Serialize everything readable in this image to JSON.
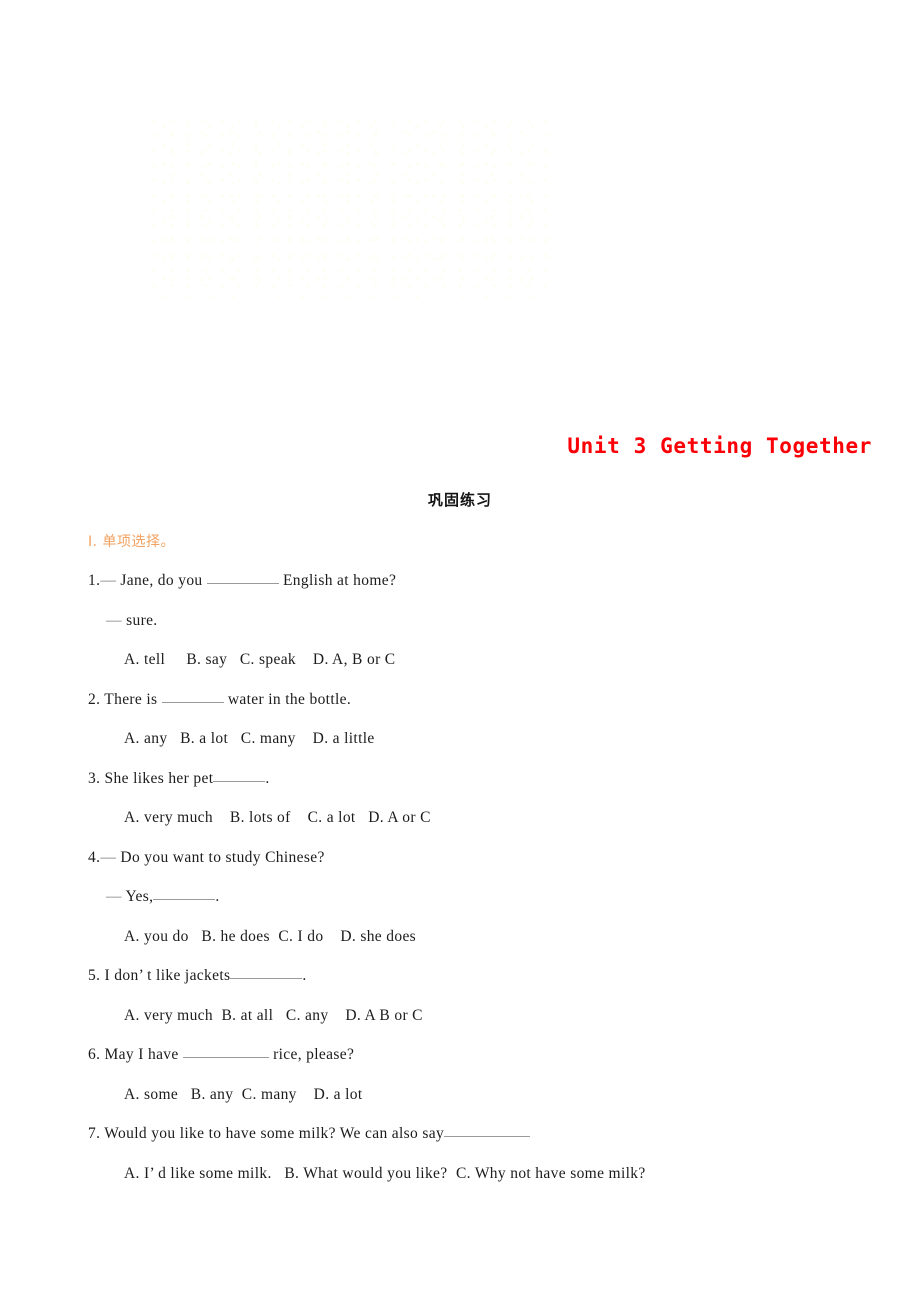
{
  "document": {
    "title": "Unit 3 Getting Together",
    "subtitle": "巩固练习",
    "title_color": "#fb0007",
    "heading_color": "#f2a261",
    "body_color": "#1c1c1c"
  },
  "watermark": {
    "present": true,
    "color": "#fffde0"
  },
  "section": {
    "label": "Ⅰ. 单项选择。"
  },
  "questions": [
    {
      "number": "1.",
      "dash": "—",
      "stem_before": " Jane, do you ",
      "blank": "blank",
      "stem_after": " English at home?",
      "reply_dash": "—",
      "reply": " sure.",
      "options": "A. tell     B. say   C. speak    D. A, B or C"
    },
    {
      "number": "2.",
      "stem_before": " There is ",
      "blank": "blank",
      "stem_after": " water in the bottle.",
      "options": "A. any   B. a lot   C. many    D. a little"
    },
    {
      "number": "3.",
      "stem_before": " She likes her pet",
      "blank": "blank",
      "stem_after": ".",
      "options": "A. very much    B. lots of    C. a lot   D. A or C"
    },
    {
      "number": "4.",
      "dash": "—",
      "stem_before": " Do you want to study Chinese?",
      "reply_dash": "—",
      "reply_before": " Yes,",
      "blank": "blank",
      "reply_after": ".",
      "options": "A. you do   B. he does  C. I do    D. she does"
    },
    {
      "number": "5.",
      "stem_before": " I don’ t like jackets",
      "blank": "blank",
      "stem_after": ".",
      "options": "A. very much  B. at all   C. any    D. A B or C"
    },
    {
      "number": "6.",
      "stem_before": " May I have ",
      "blank": "blank",
      "stem_after": " rice, please?",
      "options": "A. some   B. any  C. many    D. a lot"
    },
    {
      "number": "7.",
      "stem_before": " Would you like to have some milk? We can also say",
      "blank": "blank",
      "stem_after": "",
      "options": "A. I’ d like some milk.   B. What would you like?  C. Why not have some milk?"
    }
  ]
}
